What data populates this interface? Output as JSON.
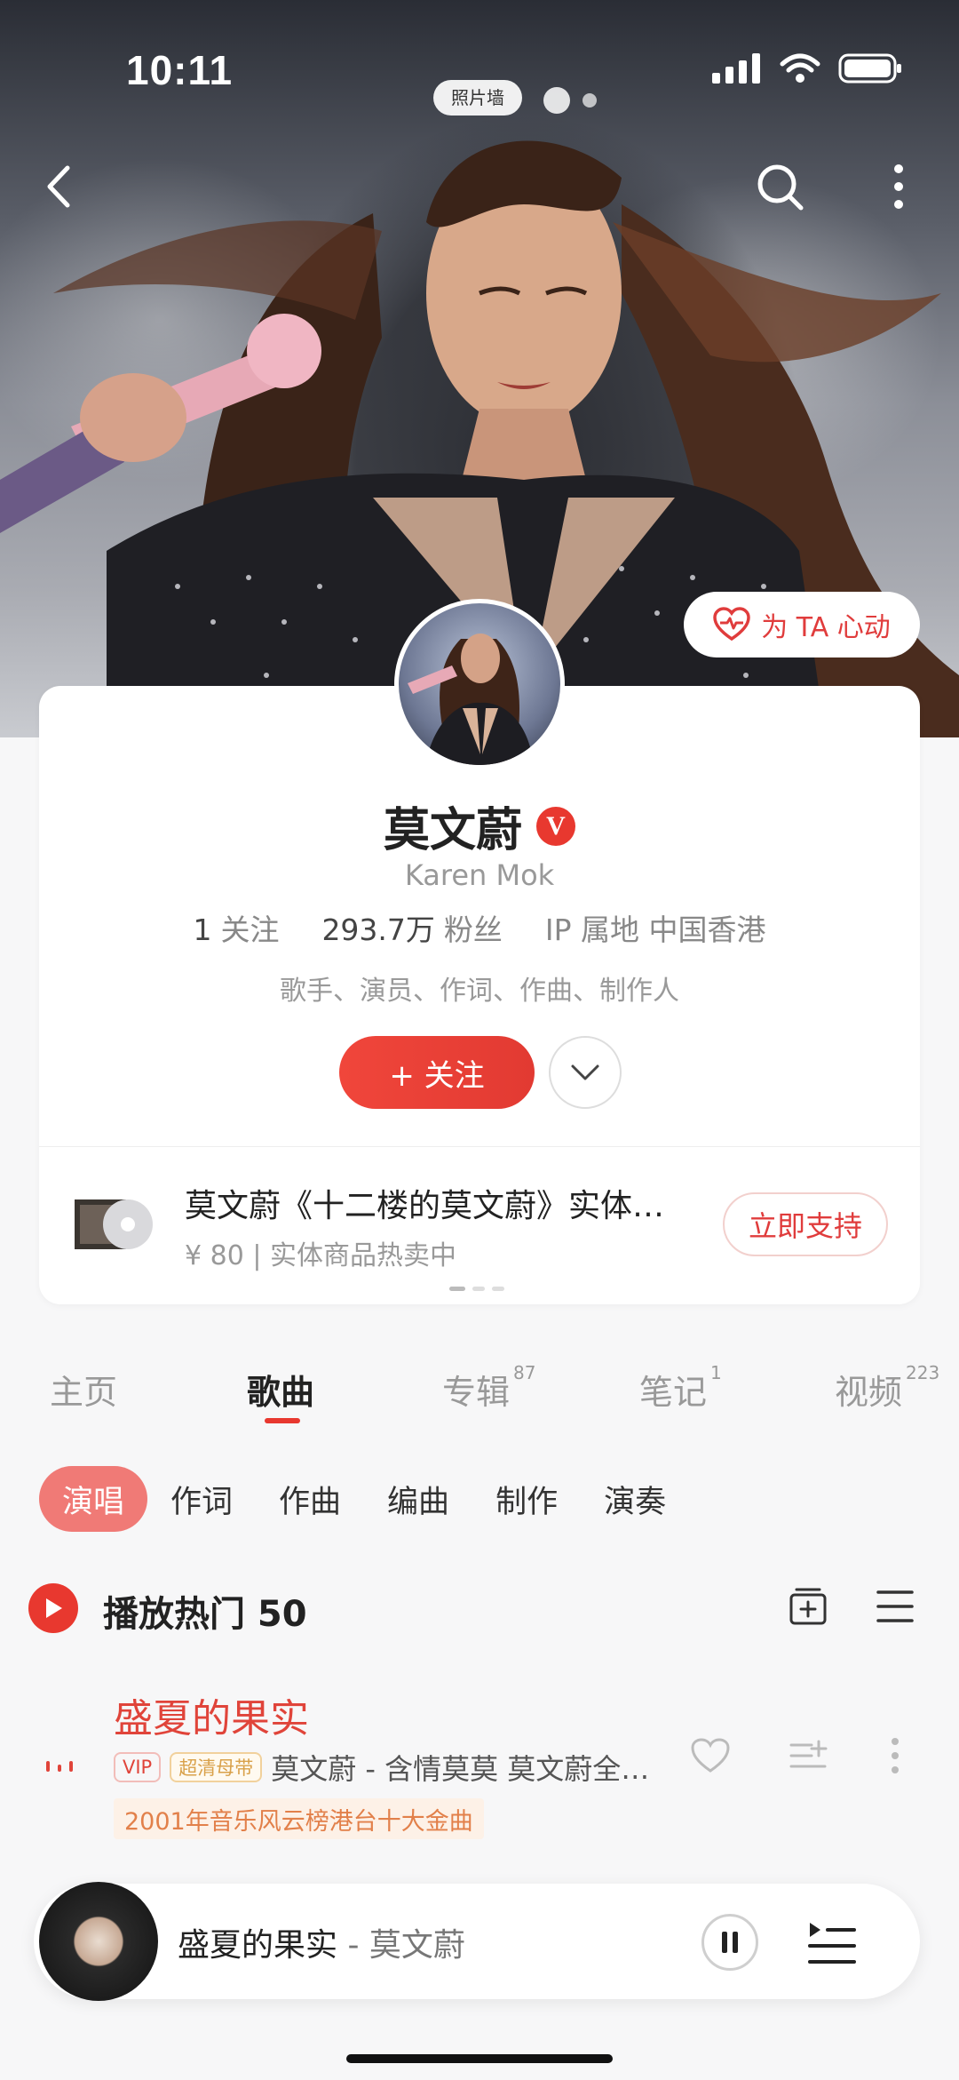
{
  "status_bar": {
    "time": "10:11"
  },
  "hero": {
    "photo_wall_label": "照片墙",
    "heart_button_label": "为 TA 心动"
  },
  "artist": {
    "name": "莫文蔚",
    "verified_mark": "V",
    "english_name": "Karen Mok",
    "following_count": "1",
    "following_label": "关注",
    "fans_count": "293.7万",
    "fans_label": "粉丝",
    "ip_label": "IP 属地",
    "ip_location": "中国香港",
    "roles": "歌手、演员、作词、作曲、制作人",
    "follow_button": "+ 关注"
  },
  "promo": {
    "title": "莫文蔚《十二楼的莫文蔚》实体…",
    "subtitle": "¥ 80 | 实体商品热卖中",
    "button": "立即支持"
  },
  "tabs": [
    {
      "label": "主页",
      "count": ""
    },
    {
      "label": "歌曲",
      "count": ""
    },
    {
      "label": "专辑",
      "count": "87"
    },
    {
      "label": "笔记",
      "count": "1"
    },
    {
      "label": "视频",
      "count": "223"
    }
  ],
  "active_tab": "歌曲",
  "filter_chips": [
    "演唱",
    "作词",
    "作曲",
    "编曲",
    "制作",
    "演奏"
  ],
  "active_chip": "演唱",
  "play_hot": {
    "label": "播放热门 50"
  },
  "song": {
    "title": "盛夏的果实",
    "vip_tag": "VIP",
    "quality_tag": "超清母带",
    "artist_album": "莫文蔚 - 含情莫莫 莫文蔚全…",
    "award": "2001年音乐风云榜港台十大金曲"
  },
  "player": {
    "title": "盛夏的果实",
    "separator": "-",
    "artist": "莫文蔚"
  },
  "colors": {
    "accent": "#e8382f",
    "chip_active": "#f07a76",
    "award_text": "#e2804a"
  }
}
